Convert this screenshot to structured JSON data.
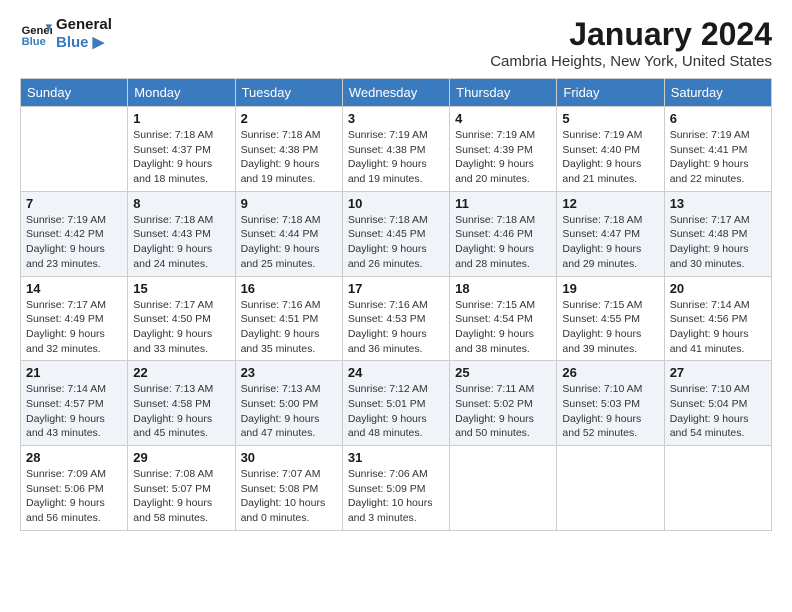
{
  "header": {
    "logo_line1": "General",
    "logo_line2": "Blue",
    "title": "January 2024",
    "location": "Cambria Heights, New York, United States"
  },
  "days_of_week": [
    "Sunday",
    "Monday",
    "Tuesday",
    "Wednesday",
    "Thursday",
    "Friday",
    "Saturday"
  ],
  "weeks": [
    [
      {
        "day": "",
        "info": ""
      },
      {
        "day": "1",
        "info": "Sunrise: 7:18 AM\nSunset: 4:37 PM\nDaylight: 9 hours\nand 18 minutes."
      },
      {
        "day": "2",
        "info": "Sunrise: 7:18 AM\nSunset: 4:38 PM\nDaylight: 9 hours\nand 19 minutes."
      },
      {
        "day": "3",
        "info": "Sunrise: 7:19 AM\nSunset: 4:38 PM\nDaylight: 9 hours\nand 19 minutes."
      },
      {
        "day": "4",
        "info": "Sunrise: 7:19 AM\nSunset: 4:39 PM\nDaylight: 9 hours\nand 20 minutes."
      },
      {
        "day": "5",
        "info": "Sunrise: 7:19 AM\nSunset: 4:40 PM\nDaylight: 9 hours\nand 21 minutes."
      },
      {
        "day": "6",
        "info": "Sunrise: 7:19 AM\nSunset: 4:41 PM\nDaylight: 9 hours\nand 22 minutes."
      }
    ],
    [
      {
        "day": "7",
        "info": "Sunrise: 7:19 AM\nSunset: 4:42 PM\nDaylight: 9 hours\nand 23 minutes."
      },
      {
        "day": "8",
        "info": "Sunrise: 7:18 AM\nSunset: 4:43 PM\nDaylight: 9 hours\nand 24 minutes."
      },
      {
        "day": "9",
        "info": "Sunrise: 7:18 AM\nSunset: 4:44 PM\nDaylight: 9 hours\nand 25 minutes."
      },
      {
        "day": "10",
        "info": "Sunrise: 7:18 AM\nSunset: 4:45 PM\nDaylight: 9 hours\nand 26 minutes."
      },
      {
        "day": "11",
        "info": "Sunrise: 7:18 AM\nSunset: 4:46 PM\nDaylight: 9 hours\nand 28 minutes."
      },
      {
        "day": "12",
        "info": "Sunrise: 7:18 AM\nSunset: 4:47 PM\nDaylight: 9 hours\nand 29 minutes."
      },
      {
        "day": "13",
        "info": "Sunrise: 7:17 AM\nSunset: 4:48 PM\nDaylight: 9 hours\nand 30 minutes."
      }
    ],
    [
      {
        "day": "14",
        "info": "Sunrise: 7:17 AM\nSunset: 4:49 PM\nDaylight: 9 hours\nand 32 minutes."
      },
      {
        "day": "15",
        "info": "Sunrise: 7:17 AM\nSunset: 4:50 PM\nDaylight: 9 hours\nand 33 minutes."
      },
      {
        "day": "16",
        "info": "Sunrise: 7:16 AM\nSunset: 4:51 PM\nDaylight: 9 hours\nand 35 minutes."
      },
      {
        "day": "17",
        "info": "Sunrise: 7:16 AM\nSunset: 4:53 PM\nDaylight: 9 hours\nand 36 minutes."
      },
      {
        "day": "18",
        "info": "Sunrise: 7:15 AM\nSunset: 4:54 PM\nDaylight: 9 hours\nand 38 minutes."
      },
      {
        "day": "19",
        "info": "Sunrise: 7:15 AM\nSunset: 4:55 PM\nDaylight: 9 hours\nand 39 minutes."
      },
      {
        "day": "20",
        "info": "Sunrise: 7:14 AM\nSunset: 4:56 PM\nDaylight: 9 hours\nand 41 minutes."
      }
    ],
    [
      {
        "day": "21",
        "info": "Sunrise: 7:14 AM\nSunset: 4:57 PM\nDaylight: 9 hours\nand 43 minutes."
      },
      {
        "day": "22",
        "info": "Sunrise: 7:13 AM\nSunset: 4:58 PM\nDaylight: 9 hours\nand 45 minutes."
      },
      {
        "day": "23",
        "info": "Sunrise: 7:13 AM\nSunset: 5:00 PM\nDaylight: 9 hours\nand 47 minutes."
      },
      {
        "day": "24",
        "info": "Sunrise: 7:12 AM\nSunset: 5:01 PM\nDaylight: 9 hours\nand 48 minutes."
      },
      {
        "day": "25",
        "info": "Sunrise: 7:11 AM\nSunset: 5:02 PM\nDaylight: 9 hours\nand 50 minutes."
      },
      {
        "day": "26",
        "info": "Sunrise: 7:10 AM\nSunset: 5:03 PM\nDaylight: 9 hours\nand 52 minutes."
      },
      {
        "day": "27",
        "info": "Sunrise: 7:10 AM\nSunset: 5:04 PM\nDaylight: 9 hours\nand 54 minutes."
      }
    ],
    [
      {
        "day": "28",
        "info": "Sunrise: 7:09 AM\nSunset: 5:06 PM\nDaylight: 9 hours\nand 56 minutes."
      },
      {
        "day": "29",
        "info": "Sunrise: 7:08 AM\nSunset: 5:07 PM\nDaylight: 9 hours\nand 58 minutes."
      },
      {
        "day": "30",
        "info": "Sunrise: 7:07 AM\nSunset: 5:08 PM\nDaylight: 10 hours\nand 0 minutes."
      },
      {
        "day": "31",
        "info": "Sunrise: 7:06 AM\nSunset: 5:09 PM\nDaylight: 10 hours\nand 3 minutes."
      },
      {
        "day": "",
        "info": ""
      },
      {
        "day": "",
        "info": ""
      },
      {
        "day": "",
        "info": ""
      }
    ]
  ]
}
